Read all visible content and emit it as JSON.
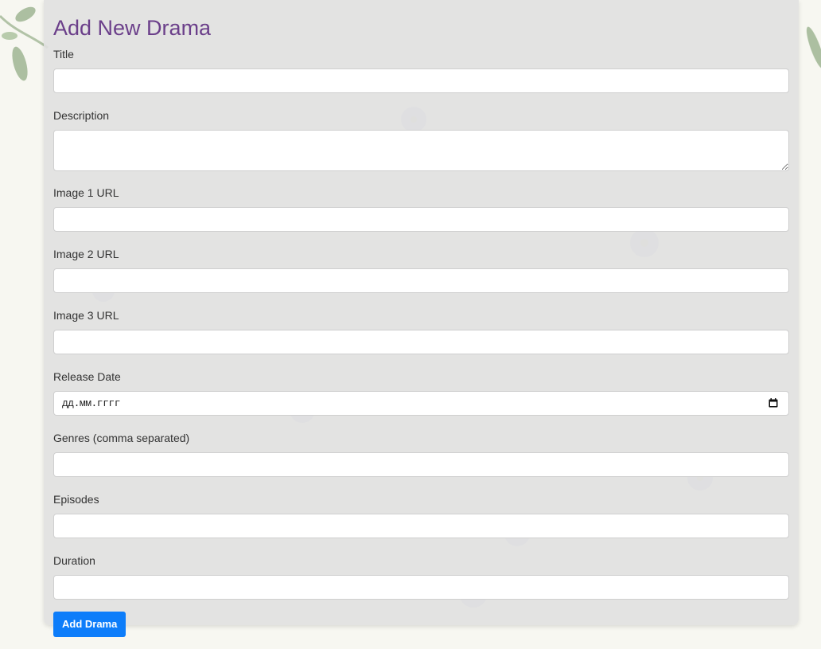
{
  "form": {
    "title": "Add New Drama",
    "submit_label": "Add Drama",
    "fields": {
      "title": {
        "label": "Title",
        "value": ""
      },
      "description": {
        "label": "Description",
        "value": ""
      },
      "image1": {
        "label": "Image 1 URL",
        "value": ""
      },
      "image2": {
        "label": "Image 2 URL",
        "value": ""
      },
      "image3": {
        "label": "Image 3 URL",
        "value": ""
      },
      "release_date": {
        "label": "Release Date",
        "placeholder": "дд.мм.гггг"
      },
      "genres": {
        "label": "Genres (comma separated)",
        "value": ""
      },
      "episodes": {
        "label": "Episodes",
        "value": ""
      },
      "duration": {
        "label": "Duration",
        "value": ""
      }
    }
  },
  "colors": {
    "title": "#6b3f8a",
    "button": "#0d7dfa",
    "card": "#e0e0e0",
    "page_background": "#f7f7f1",
    "flower_petal": "#7f93c9"
  },
  "icons": {
    "date_picker": "calendar-icon",
    "textarea_resize": "resize-grip-icon"
  }
}
